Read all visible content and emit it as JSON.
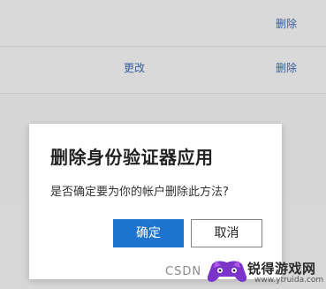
{
  "rows": [
    {
      "delete_label": "删除"
    },
    {
      "change_label": "更改",
      "delete_label": "删除"
    }
  ],
  "dialog": {
    "title": "删除身份验证器应用",
    "message": "是否确定要为你的帐户删除此方法?",
    "ok_label": "确定",
    "cancel_label": "取消"
  },
  "watermark": {
    "csdn": "CSDN",
    "brand_name": "锐得游戏网",
    "brand_url": "www.ytruida.com"
  },
  "colors": {
    "link": "#355e9e",
    "primary_button": "#1f74d0",
    "overlay": "#d7d7d7"
  }
}
